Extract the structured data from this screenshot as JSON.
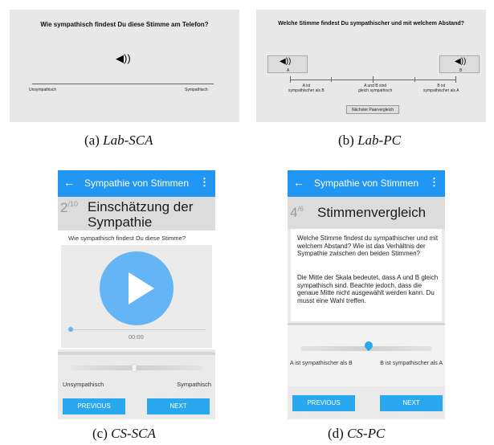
{
  "lab_sca": {
    "question": "Wie sympathisch findest Du diese Stimme am Telefon?",
    "left_label": "Unsympathisch",
    "right_label": "Sympathisch",
    "speaker_icon": "speaker-icon",
    "caption_prefix": "(a) ",
    "caption_name": "Lab-SCA"
  },
  "lab_pc": {
    "question": "Welche Stimme findest Du sympathischer und mit welchem Abstand?",
    "label_a": "A",
    "label_b": "B",
    "scale_left": "A ist\nsympathischer als B",
    "scale_mid": "A und B sind\ngleich sympathisch",
    "scale_right": "B ist\nsympathischer als A",
    "next_button": "Nächster Paarvergleich",
    "caption_prefix": "(b) ",
    "caption_name": "Lab-PC"
  },
  "cs_sca": {
    "app_title": "Sympathie von Stimmen",
    "step_current": "2",
    "step_total": "/10",
    "heading": "Einschätzung der Sympathie",
    "question": "Wie sympathisch findest Du diese Stimme?",
    "time": "00:00",
    "left_label": "Unsympathisch",
    "right_label": "Sympathisch",
    "prev_button": "PREVIOUS",
    "next_button": "NEXT",
    "caption_prefix": "(c) ",
    "caption_name": "CS-SCA"
  },
  "cs_pc": {
    "app_title": "Sympathie von Stimmen",
    "step_current": "4",
    "step_total": "/6",
    "heading": "Stimmenvergleich",
    "paragraph1": "Welche Stimme findest du sympathischer und mit welchem Abstand? Wie ist das Verhältnis der Sympathie zwischen den beiden Stimmen?",
    "paragraph2": "Die Mitte der Skala bedeutet, dass A und B gleich sympathisch sind. Beachte jedoch, dass die genaue Mitte nicht ausgewählt werden kann. Du musst eine Wahl treffen.",
    "left_label": "A ist sympathischer als B",
    "right_label": "B ist sympathischer als A",
    "prev_button": "PREVIOUS",
    "next_button": "NEXT",
    "caption_prefix": "(d) ",
    "caption_name": "CS-PC"
  },
  "colors": {
    "accent": "#2196f3",
    "button": "#29a8f0",
    "play": "#64b5f6"
  }
}
